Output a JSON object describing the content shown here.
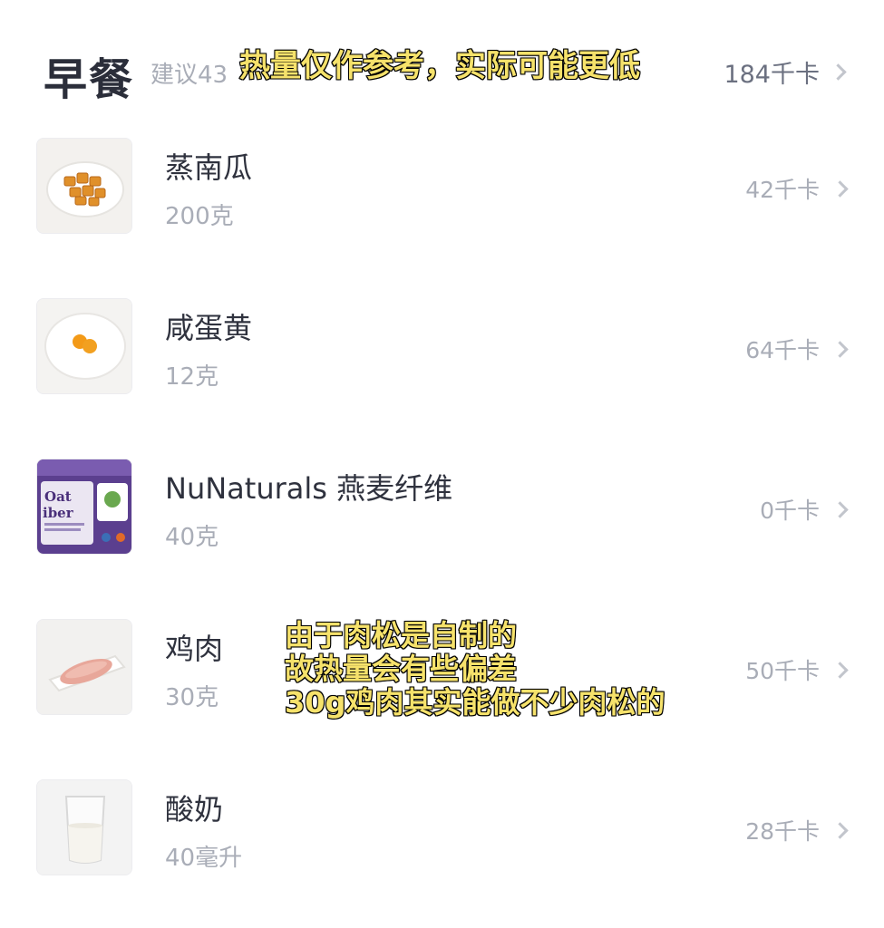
{
  "header": {
    "meal": "早餐",
    "suggestion": "建议43",
    "total": "184千卡"
  },
  "captions": {
    "top": "热量仅作参考，实际可能更低",
    "middle": [
      "由于肉松是自制的",
      "故热量会有些偏差",
      "30g鸡肉其实能做不少肉松的"
    ]
  },
  "foods": [
    {
      "name": "蒸南瓜",
      "amount": "200克",
      "calories": "42千卡",
      "image_icon": "pumpkin-plate"
    },
    {
      "name": "咸蛋黄",
      "amount": "12克",
      "calories": "64千卡",
      "image_icon": "egg-yolk-plate"
    },
    {
      "name": "NuNaturals 燕麦纤维",
      "amount": "40克",
      "calories": "0千卡",
      "image_icon": "oat-fiber-bag"
    },
    {
      "name": "鸡肉",
      "amount": "30克",
      "calories": "50千卡",
      "image_icon": "chicken-plate"
    },
    {
      "name": "酸奶",
      "amount": "40毫升",
      "calories": "28千卡",
      "image_icon": "yogurt-glass"
    }
  ],
  "colors": {
    "caption_fill": "#f6e26b",
    "caption_stroke": "#1a1a1a",
    "muted_text": "#a9adb7",
    "primary_text": "#2b2e3a"
  }
}
